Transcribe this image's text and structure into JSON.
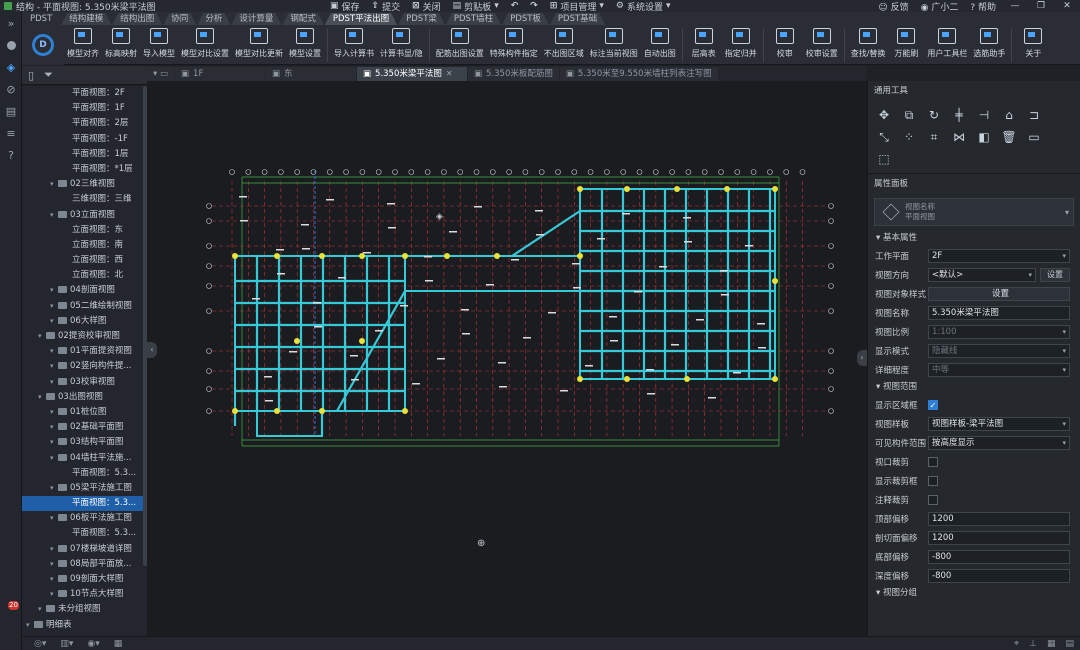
{
  "window": {
    "title": "结构 - 平面视图: 5.350米梁平法图",
    "quick_access": [
      "保存",
      "提交",
      "关闭",
      "剪贴板",
      "项目管理",
      "系统设置"
    ],
    "user": {
      "feedback": "反馈",
      "name": "广小二",
      "help": "帮助"
    }
  },
  "ribbon_tabs": [
    "PDST",
    "结构建模",
    "结构出图",
    "协同",
    "分析",
    "设计算量",
    "钢配式",
    "PDST平法出图",
    "PDST梁",
    "PDST墙柱",
    "PDST板",
    "PDST基础"
  ],
  "ribbon_active": "PDST平法出图",
  "ribbon_buttons": [
    "模型对齐",
    "标高映射",
    "导入模型",
    "模型对比设置",
    "模型对比更新",
    "模型设置",
    "导入计算书",
    "计算书显/隐",
    "配筋出图设置",
    "特殊构件指定",
    "不出图区域",
    "标注当前视图",
    "自动出图",
    "层高表",
    "指定归并",
    "校审",
    "校审设置",
    "查找/替换",
    "万能刷",
    "用户工具栏",
    "选筋助手",
    "关于"
  ],
  "tree": [
    {
      "label": "平面视图：2F",
      "level": 3
    },
    {
      "label": "平面视图：1F",
      "level": 3
    },
    {
      "label": "平面视图：2层",
      "level": 3
    },
    {
      "label": "平面视图：-1F",
      "level": 3
    },
    {
      "label": "平面视图：1层",
      "level": 3
    },
    {
      "label": "平面视图：*1层",
      "level": 3
    },
    {
      "label": "02三维视图",
      "level": 2,
      "folder": true
    },
    {
      "label": "三维视图：三维",
      "level": 3
    },
    {
      "label": "03立面视图",
      "level": 2,
      "folder": true
    },
    {
      "label": "立面视图：东",
      "level": 3
    },
    {
      "label": "立面视图：南",
      "level": 3
    },
    {
      "label": "立面视图：西",
      "level": 3
    },
    {
      "label": "立面视图：北",
      "level": 3
    },
    {
      "label": "04剖面视图",
      "level": 2,
      "folder": true
    },
    {
      "label": "05二维绘制视图",
      "level": 2,
      "folder": true
    },
    {
      "label": "06大样图",
      "level": 2,
      "folder": true
    },
    {
      "label": "02提资校审视图",
      "level": 1,
      "folder": true
    },
    {
      "label": "01平面提资视图",
      "level": 2,
      "folder": true
    },
    {
      "label": "02竖向构件提...",
      "level": 2,
      "folder": true
    },
    {
      "label": "03校审视图",
      "level": 2,
      "folder": true
    },
    {
      "label": "03出图视图",
      "level": 1,
      "folder": true
    },
    {
      "label": "01桩位图",
      "level": 2,
      "folder": true
    },
    {
      "label": "02基础平面图",
      "level": 2,
      "folder": true
    },
    {
      "label": "03结构平面图",
      "level": 2,
      "folder": true
    },
    {
      "label": "04墙柱平法施...",
      "level": 2,
      "folder": true
    },
    {
      "label": "平面视图：5.3...",
      "level": 3
    },
    {
      "label": "05梁平法施工图",
      "level": 2,
      "folder": true
    },
    {
      "label": "平面视图：5.3...",
      "level": 3,
      "selected": true
    },
    {
      "label": "06板平法施工图",
      "level": 2,
      "folder": true
    },
    {
      "label": "平面视图：5.3...",
      "level": 3
    },
    {
      "label": "07楼梯坡道详图",
      "level": 2,
      "folder": true
    },
    {
      "label": "08局部平面放...",
      "level": 2,
      "folder": true
    },
    {
      "label": "09剖面大样图",
      "level": 2,
      "folder": true
    },
    {
      "label": "10节点大样图",
      "level": 2,
      "folder": true
    },
    {
      "label": "未分组视图",
      "level": 1,
      "folder": true
    },
    {
      "label": "明细表",
      "level": 0,
      "folder": true
    }
  ],
  "doc_tabs": [
    {
      "label": "1F",
      "active": false
    },
    {
      "label": "东",
      "active": false
    },
    {
      "label": "5.350米梁平法图",
      "active": true
    },
    {
      "label": "5.350米板配筋图",
      "active": false
    },
    {
      "label": "5.350米至9.550米墙柱列表注写图",
      "active": false
    }
  ],
  "right_panel": {
    "tools_title": "通用工具",
    "props_title": "属性面板",
    "view_card": {
      "line1": "视图名称",
      "line2": "平面视图"
    },
    "basic_section": "基本属性",
    "props": [
      {
        "label": "工作平面",
        "value": "2F",
        "type": "select"
      },
      {
        "label": "视图方向",
        "value": "<默认>",
        "type": "select-btn",
        "btn": "设置"
      },
      {
        "label": "视图对象样式",
        "value": "设置",
        "type": "button"
      },
      {
        "label": "视图名称",
        "value": "5.350米梁平法图",
        "type": "text"
      },
      {
        "label": "视图比例",
        "value": "1:100",
        "type": "select",
        "disabled": true
      },
      {
        "label": "显示模式",
        "value": "隐藏线",
        "type": "select",
        "disabled": true
      },
      {
        "label": "详细程度",
        "value": "中等",
        "type": "select",
        "disabled": true
      }
    ],
    "range_section": "视图范围",
    "range_props": [
      {
        "label": "显示区域框",
        "type": "check",
        "checked": true
      },
      {
        "label": "视图样板",
        "value": "视图样板-梁平法图",
        "type": "select"
      },
      {
        "label": "可见构件范围",
        "value": "按高度显示",
        "type": "select"
      },
      {
        "label": "视口裁剪",
        "type": "check",
        "checked": false
      },
      {
        "label": "显示裁剪框",
        "type": "check",
        "checked": false
      },
      {
        "label": "注释裁剪",
        "type": "check",
        "checked": false
      },
      {
        "label": "顶部偏移",
        "value": "1200",
        "type": "text"
      },
      {
        "label": "剖切面偏移",
        "value": "1200",
        "type": "text"
      },
      {
        "label": "底部偏移",
        "value": "-800",
        "type": "text"
      },
      {
        "label": "深度偏移",
        "value": "-800",
        "type": "text"
      }
    ],
    "group_section": "视图分组"
  },
  "notification_count": "20",
  "colors": {
    "accent": "#2f7fd6",
    "beam": "#36c9d8",
    "grid_red": "#c0333a",
    "grid_green": "#3fb04a",
    "bg": "#1a1c1f"
  }
}
